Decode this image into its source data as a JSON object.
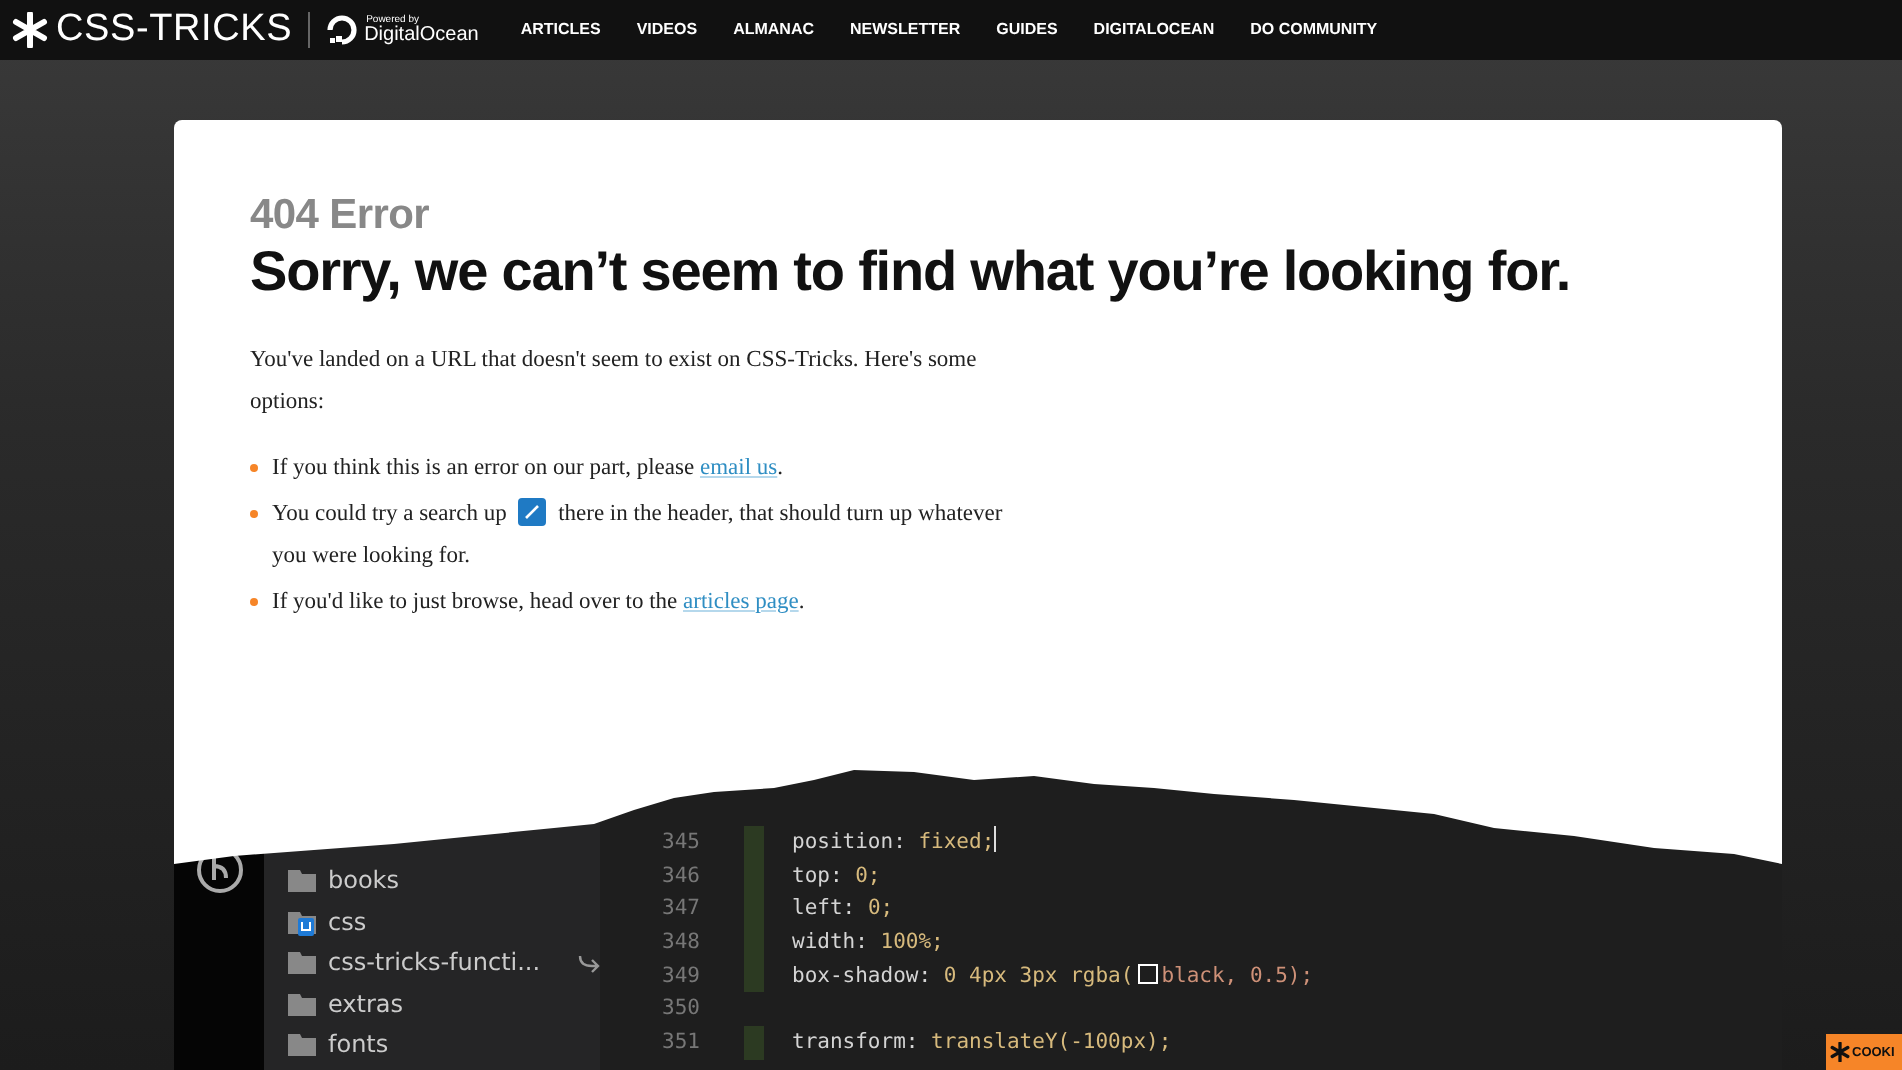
{
  "header": {
    "logo_text": "CSS-TRICKS",
    "powered_by": "Powered by",
    "sponsor": "DigitalOcean",
    "nav": [
      "ARTICLES",
      "VIDEOS",
      "ALMANAC",
      "NEWSLETTER",
      "GUIDES",
      "DIGITALOCEAN",
      "DO COMMUNITY"
    ]
  },
  "error": {
    "code": "404 Error",
    "heading": "Sorry, we can’t seem to find what you’re looking for.",
    "intro": "You've landed on a URL that doesn't seem to exist on CSS-Tricks. Here's some options:",
    "options": [
      {
        "kind": "link",
        "before": "If you think this is an error on our part, please",
        "link": "email us",
        "after": "."
      },
      {
        "kind": "search",
        "before": "You could try a search up",
        "after": "there in the header, that should turn up whatever you were looking for."
      },
      {
        "kind": "link",
        "before": "If you'd like to just browse, head over to the",
        "link": "articles page",
        "after": "."
      }
    ]
  },
  "editor": {
    "files": [
      {
        "name": "books",
        "kind": "folder"
      },
      {
        "name": "css",
        "kind": "special"
      },
      {
        "name": "css-tricks-functi...",
        "kind": "link"
      },
      {
        "name": "extras",
        "kind": "folder"
      },
      {
        "name": "fonts",
        "kind": "folder"
      }
    ],
    "lines": [
      {
        "number": "345",
        "kind": "decl",
        "property": "position: ",
        "value": "fixed;",
        "cursor": true
      },
      {
        "number": "346",
        "kind": "decl",
        "property": "top: ",
        "value": "0;",
        "cursor": false
      },
      {
        "number": "347",
        "kind": "decl",
        "property": "left: ",
        "value": "0;",
        "cursor": false
      },
      {
        "number": "348",
        "kind": "decl",
        "property": "width: ",
        "value": "100%;",
        "cursor": false
      },
      {
        "number": "349",
        "kind": "swatch",
        "property": "box-shadow: ",
        "value": "0 4px 3px rgba(",
        "tail": "black, 0.5);",
        "cursor": false
      },
      {
        "number": "350",
        "kind": "blank",
        "cursor": false
      },
      {
        "number": "351",
        "kind": "decl",
        "property": "transform: ",
        "value": "translateY(-100px);",
        "cursor": false
      }
    ]
  },
  "cookie": {
    "label": "COOKI"
  }
}
